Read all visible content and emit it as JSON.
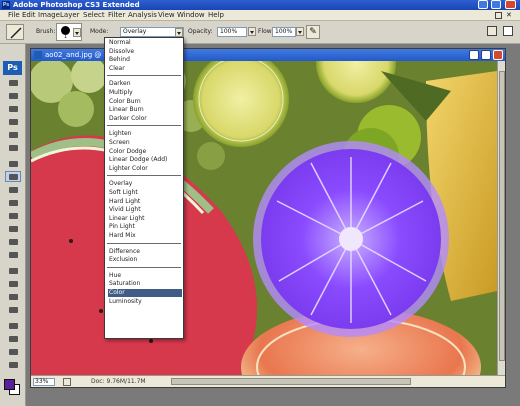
{
  "window": {
    "title": "Adobe Photoshop CS3 Extended",
    "app_icon_text": "Ps"
  },
  "menu": [
    "File",
    "Edit",
    "Image",
    "Layer",
    "Select",
    "Filter",
    "Analysis",
    "View",
    "Window",
    "Help"
  ],
  "options": {
    "brush_label": "Brush:",
    "brush_size": "1",
    "mode_label": "Mode:",
    "mode_value": "Overlay",
    "opacity_label": "Opacity:",
    "opacity_value": "100%",
    "flow_label": "Flow:",
    "flow_value": "100%"
  },
  "toolbox": {
    "logo": "Ps",
    "tools": [
      "move-tool",
      "marquee-tool",
      "lasso-tool",
      "magic-wand-tool",
      "crop-tool",
      "slice-tool",
      "healing-brush-tool",
      "brush-tool",
      "clone-stamp-tool",
      "history-brush-tool",
      "eraser-tool",
      "gradient-tool",
      "blur-tool",
      "dodge-tool",
      "pen-tool",
      "type-tool",
      "path-selection-tool",
      "shape-tool",
      "notes-tool",
      "eyedropper-tool",
      "hand-tool",
      "zoom-tool"
    ],
    "active_tool": "brush-tool",
    "foreground_color": "#5a1f9a",
    "background_color": "#ffffff"
  },
  "document": {
    "title": "ao02_and.jpg @ 2",
    "zoom": "33%",
    "doc_size": "Doc: 9.76M/11.7M"
  },
  "blend_modes": {
    "groups": [
      [
        "Normal",
        "Dissolve",
        "Behind",
        "Clear"
      ],
      [
        "Darken",
        "Multiply",
        "Color Burn",
        "Linear Burn",
        "Darker Color"
      ],
      [
        "Lighten",
        "Screen",
        "Color Dodge",
        "Linear Dodge (Add)",
        "Lighter Color"
      ],
      [
        "Overlay",
        "Soft Light",
        "Hard Light",
        "Vivid Light",
        "Linear Light",
        "Pin Light",
        "Hard Mix"
      ],
      [
        "Difference",
        "Exclusion"
      ],
      [
        "Hue",
        "Saturation",
        "Color",
        "Luminosity"
      ]
    ],
    "selected": "Color"
  },
  "colors": {
    "title_bar": "#2459c9",
    "selection_highlight": "#3f5d87",
    "purple_overlay": "#8a4bff"
  }
}
